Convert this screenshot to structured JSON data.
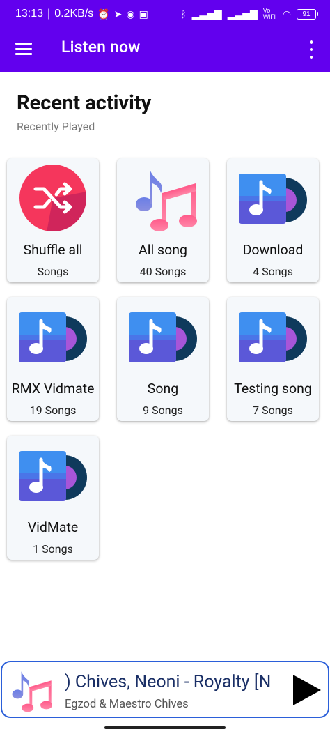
{
  "status_bar": {
    "time": "13:13",
    "speed": "0.2KB/s",
    "net_label": "Vo WiFi",
    "battery": "91"
  },
  "app_bar": {
    "title": "Listen now",
    "menu_icon": "hamburger-menu-icon",
    "more_icon": "more-vert-icon"
  },
  "recent": {
    "title": "Recent activity",
    "subtitle": "Recently Played"
  },
  "cards": [
    {
      "title": "Shuffle all",
      "count": "Songs",
      "icon": "shuffle-icon"
    },
    {
      "title": "All song",
      "count": "40 Songs",
      "icon": "music-notes-icon"
    },
    {
      "title": "Download",
      "count": "4 Songs",
      "icon": "playlist-disc-icon"
    },
    {
      "title": "RMX Vidmate",
      "count": "19 Songs",
      "icon": "playlist-disc-icon"
    },
    {
      "title": "Song",
      "count": "9 Songs",
      "icon": "playlist-disc-icon"
    },
    {
      "title": "Testing song",
      "count": "7 Songs",
      "icon": "playlist-disc-icon"
    },
    {
      "title": "VidMate",
      "count": "1 Songs",
      "icon": "playlist-disc-icon"
    }
  ],
  "mini_player": {
    "title": ") Chives, Neoni - Royalty [N",
    "artist": "Egzod & Maestro Chives",
    "play_icon": "play-icon"
  },
  "colors": {
    "primary": "#6200ee",
    "card_bg": "#f5f8fb",
    "player_border": "#2b5fd9"
  }
}
